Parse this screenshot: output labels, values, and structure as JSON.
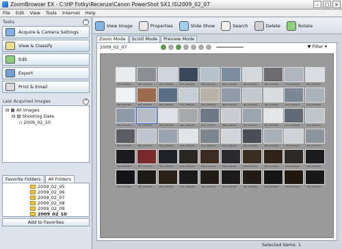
{
  "title": "ZoomBrowser EX  -  C:\\HP Fotky\\Recenze\\Canon PowerShot SX1 IS\\2009_02_07",
  "menu": [
    "File",
    "Edit",
    "View",
    "Tools",
    "Internet",
    "Help"
  ],
  "tasks": {
    "header": "Tasks",
    "items": [
      "Acquire & Camera Settings",
      "View & Classify",
      "Edit",
      "Export",
      "Print & Email"
    ]
  },
  "last_acquired": {
    "header": "Last Acquired Images",
    "all_images": "All Images",
    "shooting_date": "Shooting Date",
    "date": "2009_02_10"
  },
  "folder_tabs": [
    "Favorite Folders",
    "All Folders"
  ],
  "folders": [
    "2009_02_05",
    "2009_02_06",
    "2009_02_07",
    "2009_02_08",
    "2009_02_09",
    "2009_02_10"
  ],
  "add_favorites": "Add to Favorites",
  "toolbar": [
    "View Image",
    "Properties",
    "Slide Show",
    "Search",
    "Delete",
    "Rotate"
  ],
  "modes": [
    "Zoom Mode",
    "Scroll Mode",
    "Preview Mode"
  ],
  "current_folder": "2009_02_07",
  "filter": "Filter",
  "thumb_label": "IMG_0438.JPG",
  "status": "Selected Items: 1",
  "colors": {
    "accent": "#3a6de0",
    "panel": "#dde3ea",
    "grid": "#9a9a9a"
  }
}
